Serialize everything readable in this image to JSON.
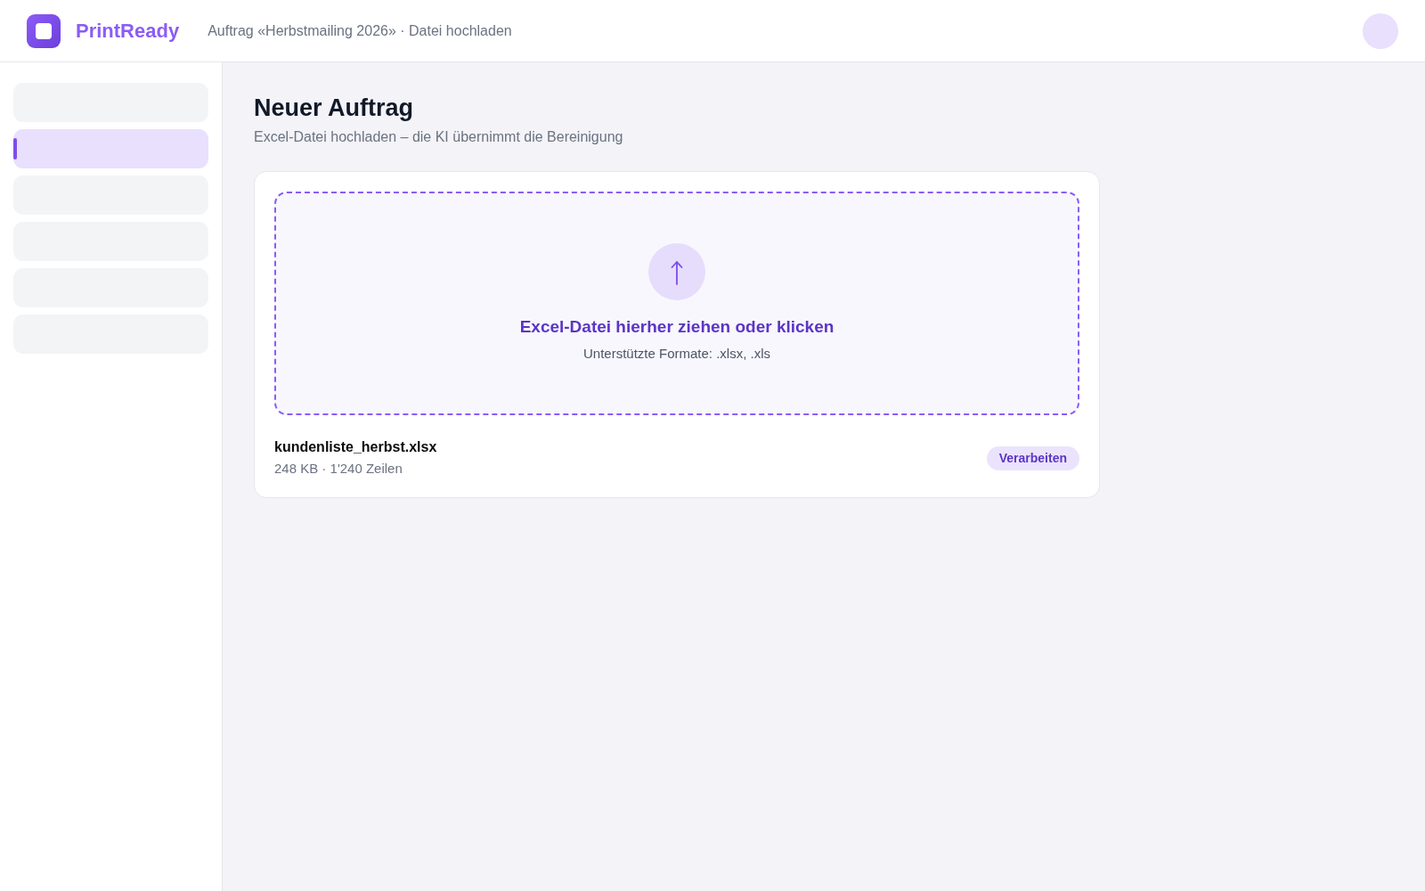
{
  "header": {
    "brand": "PrintReady",
    "breadcrumb": "Auftrag «Herbstmailing 2026» · Datei hochladen"
  },
  "sidebar": {
    "items": [
      {
        "selected": false
      },
      {
        "selected": true
      },
      {
        "selected": false
      },
      {
        "selected": false
      },
      {
        "selected": false
      },
      {
        "selected": false
      }
    ]
  },
  "page": {
    "title": "Neuer Auftrag",
    "subtitle": "Excel-Datei hochladen – die KI übernimmt die Bereinigung"
  },
  "upload": {
    "prompt": "Excel-Datei hierher ziehen oder klicken",
    "formats": "Unterstützte Formate: .xlsx, .xls"
  },
  "file": {
    "name": "kundenliste_herbst.xlsx",
    "meta": "248 KB · 1'240 Zeilen",
    "action": "Verarbeiten"
  }
}
